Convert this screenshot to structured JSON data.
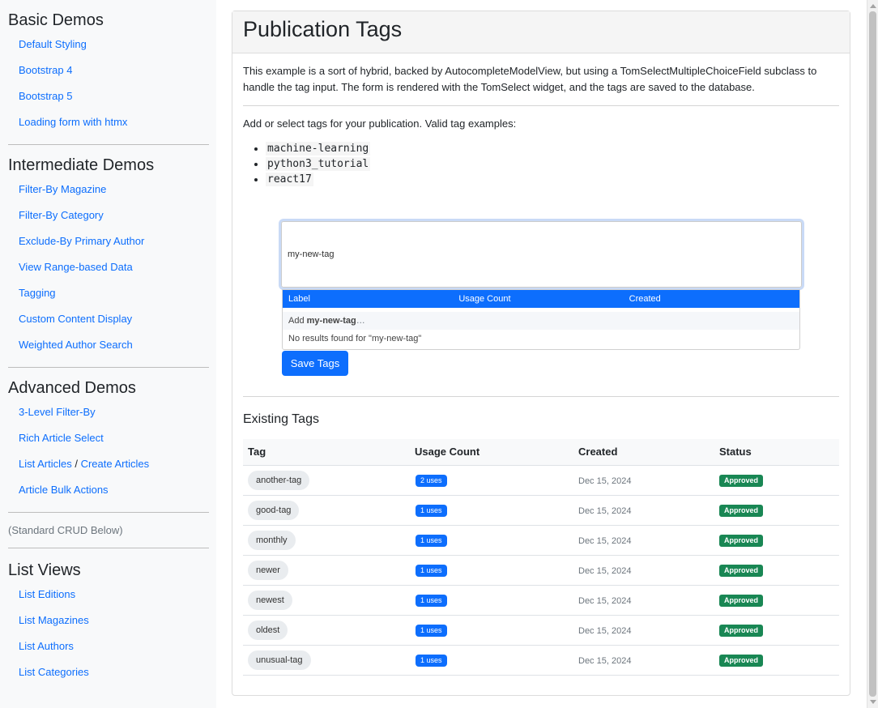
{
  "sidebar": {
    "sections": [
      {
        "title": "Basic Demos",
        "items": [
          "Default Styling",
          "Bootstrap 4",
          "Bootstrap 5",
          "Loading form with htmx"
        ]
      },
      {
        "title": "Intermediate Demos",
        "items": [
          "Filter-By Magazine",
          "Filter-By Category",
          "Exclude-By Primary Author",
          "View Range-based Data",
          "Tagging",
          "Custom Content Display",
          "Weighted Author Search"
        ]
      },
      {
        "title": "Advanced Demos",
        "items": [
          "3-Level Filter-By",
          "Rich Article Select",
          "List Articles",
          "Create Articles",
          "Article Bulk Actions"
        ]
      },
      {
        "title": "List Views",
        "items": [
          "List Editions",
          "List Magazines",
          "List Authors",
          "List Categories"
        ]
      }
    ],
    "list_articles": "List Articles",
    "slash": " / ",
    "create_articles": "Create Articles",
    "crud_note": "(Standard CRUD Below)"
  },
  "main": {
    "title": "Publication Tags",
    "intro": "This example is a sort of hybrid, backed by AutocompleteModelView, but using a TomSelectMultipleChoiceField subclass to handle the tag input. The form is rendered with the TomSelect widget, and the tags are saved to the database.",
    "prompt": "Add or select tags for your publication. Valid tag examples:",
    "examples": [
      "machine-learning",
      "python3_tutorial",
      "react17"
    ],
    "tag_input_value": "my-new-tag",
    "dropdown": {
      "headers": [
        "Label",
        "Usage Count",
        "Created"
      ],
      "add_prefix": "Add ",
      "add_value": "my-new-tag",
      "add_suffix": "…",
      "no_results": "No results found for \"my-new-tag\""
    },
    "save_button": "Save Tags",
    "existing_title": "Existing Tags",
    "table": {
      "headers": [
        "Tag",
        "Usage Count",
        "Created",
        "Status"
      ],
      "rows": [
        {
          "tag": "another-tag",
          "uses": "2 uses",
          "created": "Dec 15, 2024",
          "status": "Approved"
        },
        {
          "tag": "good-tag",
          "uses": "1 uses",
          "created": "Dec 15, 2024",
          "status": "Approved"
        },
        {
          "tag": "monthly",
          "uses": "1 uses",
          "created": "Dec 15, 2024",
          "status": "Approved"
        },
        {
          "tag": "newer",
          "uses": "1 uses",
          "created": "Dec 15, 2024",
          "status": "Approved"
        },
        {
          "tag": "newest",
          "uses": "1 uses",
          "created": "Dec 15, 2024",
          "status": "Approved"
        },
        {
          "tag": "oldest",
          "uses": "1 uses",
          "created": "Dec 15, 2024",
          "status": "Approved"
        },
        {
          "tag": "unusual-tag",
          "uses": "1 uses",
          "created": "Dec 15, 2024",
          "status": "Approved"
        }
      ]
    }
  },
  "colors": {
    "primary": "#0d6efd",
    "success": "#198754",
    "sidebar_bg": "#f8f9fa"
  }
}
